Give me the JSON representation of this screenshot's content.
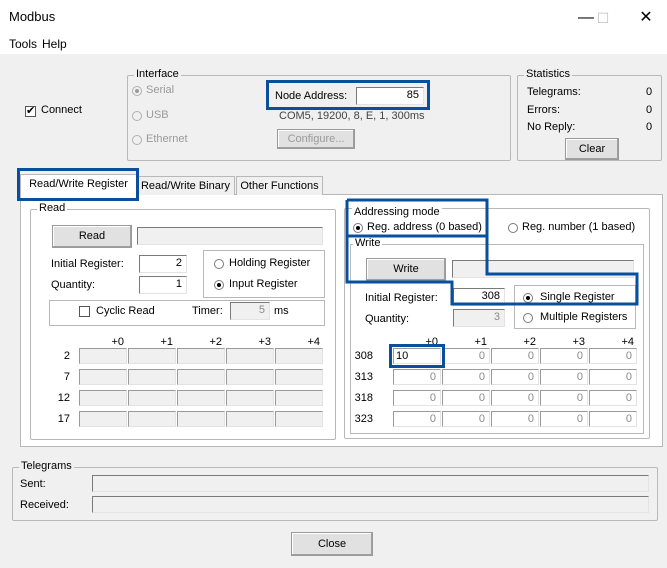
{
  "window": {
    "title": "Modbus",
    "minimize": "—",
    "maximize": "☐",
    "close": "✕"
  },
  "menu": {
    "tools": "Tools",
    "help": "Help"
  },
  "connect": {
    "label": "Connect"
  },
  "interface": {
    "label": "Interface",
    "serial": "Serial",
    "usb": "USB",
    "ethernet": "Ethernet",
    "node_address_label": "Node Address:",
    "node_address_value": "85",
    "port_info": "COM5, 19200, 8, E, 1, 300ms",
    "configure": "Configure..."
  },
  "statistics": {
    "label": "Statistics",
    "telegrams_label": "Telegrams:",
    "telegrams_value": "0",
    "errors_label": "Errors:",
    "errors_value": "0",
    "noreply_label": "No Reply:",
    "noreply_value": "0",
    "clear": "Clear"
  },
  "tabs": [
    "Read/Write Register",
    "Read/Write Binary",
    "Other Functions"
  ],
  "read": {
    "label": "Read",
    "button": "Read",
    "initial_register_label": "Initial Register:",
    "initial_register_value": "2",
    "quantity_label": "Quantity:",
    "quantity_value": "1",
    "holding": "Holding Register",
    "input": "Input Register",
    "cyclic": "Cyclic Read",
    "timer_label": "Timer:",
    "timer_value": "5",
    "timer_unit": "ms",
    "columns": [
      "+0",
      "+1",
      "+2",
      "+3",
      "+4"
    ],
    "rows": [
      "2",
      "7",
      "12",
      "17"
    ]
  },
  "addressing": {
    "label": "Addressing mode",
    "reg_address": "Reg. address (0 based)",
    "reg_number": "Reg. number (1 based)"
  },
  "write": {
    "label": "Write",
    "button": "Write",
    "initial_register_label": "Initial Register:",
    "initial_register_value": "308",
    "quantity_label": "Quantity:",
    "quantity_value": "3",
    "single": "Single Register",
    "multiple": "Multiple Registers",
    "columns": [
      "+0",
      "+1",
      "+2",
      "+3",
      "+4"
    ],
    "rows": [
      "308",
      "313",
      "318",
      "323"
    ],
    "cells": [
      [
        "10",
        "0",
        "0",
        "0",
        "0"
      ],
      [
        "0",
        "0",
        "0",
        "0",
        "0"
      ],
      [
        "0",
        "0",
        "0",
        "0",
        "0"
      ],
      [
        "0",
        "0",
        "0",
        "0",
        "0"
      ]
    ]
  },
  "telegrams": {
    "label": "Telegrams",
    "sent": "Sent:",
    "received": "Received:"
  },
  "close_button": "Close",
  "colors": {
    "highlight": "#0a4f9c"
  }
}
